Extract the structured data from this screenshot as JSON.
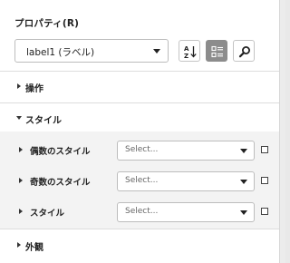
{
  "panel": {
    "title": "プロパティ(R)",
    "object_select": {
      "value": "label1 (ラベル)"
    },
    "toolbar": {
      "sort_icon": "sort-az-icon",
      "category_icon": "category-view-icon",
      "search_icon": "search-icon"
    }
  },
  "sections": {
    "operation": {
      "label": "操作",
      "expanded": false
    },
    "style": {
      "label": "スタイル",
      "expanded": true,
      "properties": [
        {
          "label": "偶数のスタイル",
          "placeholder": "Select..."
        },
        {
          "label": "奇数のスタイル",
          "placeholder": "Select..."
        },
        {
          "label": "スタイル",
          "placeholder": "Select..."
        }
      ]
    },
    "appearance": {
      "label": "外観",
      "expanded": false
    }
  }
}
